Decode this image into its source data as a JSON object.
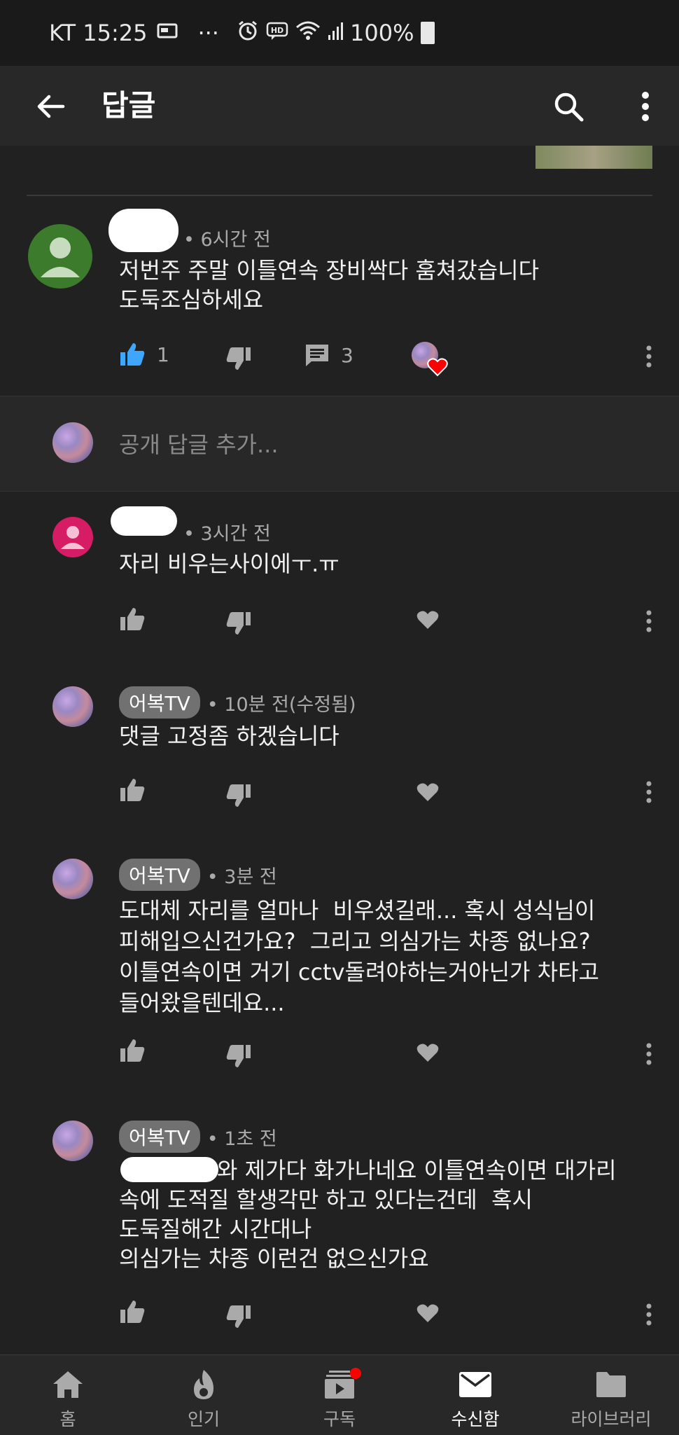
{
  "status_bar": {
    "carrier_time": "KT 15:25",
    "dots": "···",
    "battery": "100%"
  },
  "app_bar": {
    "title": "답글"
  },
  "main_comment": {
    "time": "• 6시간 전",
    "text": "저번주 주말 이틀연속 장비싹다 훔쳐갔습니다\n도둑조심하세요",
    "like_count": "1",
    "reply_count": "3"
  },
  "reply_box": {
    "placeholder": "공개 답글 추가..."
  },
  "replies": [
    {
      "time": "• 3시간 전",
      "text": "자리 비우는사이에ㅜ.ㅠ"
    },
    {
      "author": "어복TV",
      "time": "• 10분 전(수정됨)",
      "text": "댓글 고정좀 하겠습니다"
    },
    {
      "author": "어복TV",
      "time": "• 3분 전",
      "text": "도대체 자리를 얼마나  비우셨길래... 혹시 성식님이\n피해입으신건가요?  그리고 의심가는 차종 없나요?\n이틀연속이면 거기 cctv돌려야하는거아닌가 차타고\n들어왔을텐데요..."
    },
    {
      "author": "어복TV",
      "time": "• 1초 전",
      "text_line1": "와 제가다 화가나네요 이틀연속이면 대가리",
      "text_rest": "속에 도적질 할생각만 하고 있다는건데  혹시\n도둑질해간 시간대나\n의심가는 차종 이런건 없으신가요"
    }
  ],
  "bottom_nav": {
    "items": [
      {
        "label": "홈",
        "icon": "home-icon"
      },
      {
        "label": "인기",
        "icon": "trending-icon"
      },
      {
        "label": "구독",
        "icon": "subscriptions-icon"
      },
      {
        "label": "수신함",
        "icon": "inbox-icon"
      },
      {
        "label": "라이브러리",
        "icon": "library-icon"
      }
    ],
    "active_index": 3
  },
  "colors": {
    "background": "#212121",
    "like_active": "#3ea6ff",
    "heart_red": "#ff0000",
    "badge_bg": "#717171"
  }
}
